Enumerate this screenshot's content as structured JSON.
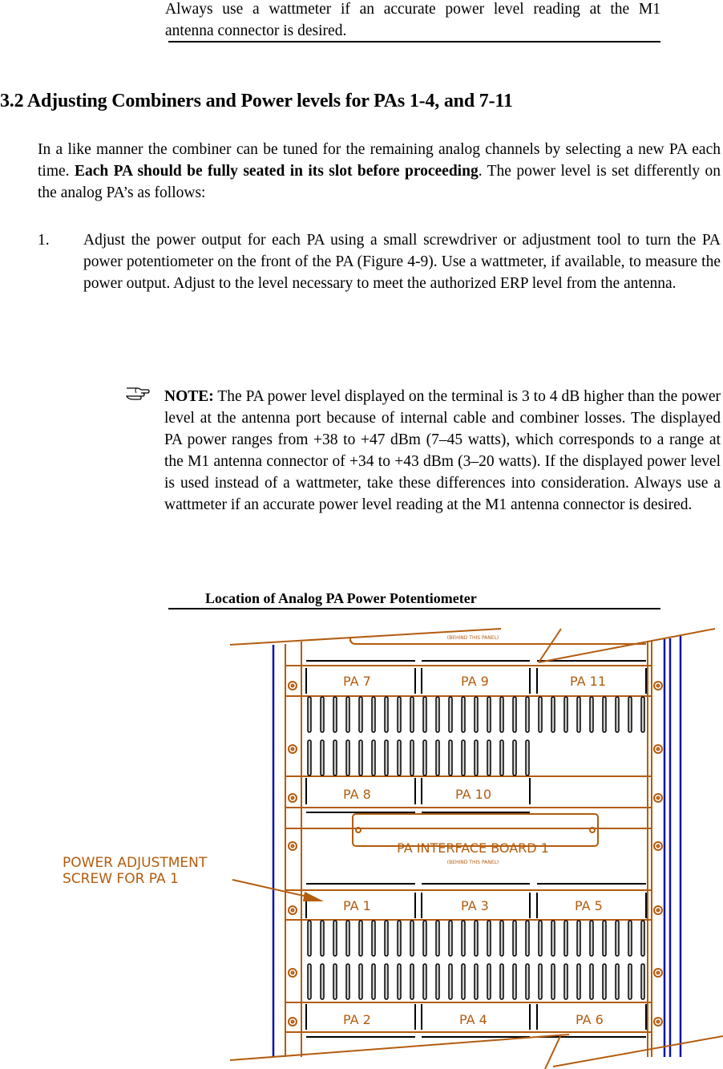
{
  "top_note_tail": {
    "line1": "Always use a wattmeter if an accurate power level reading at the M1",
    "line2": "antenna connector is desired."
  },
  "section": {
    "title": "3.2 Adjusting Combiners and Power levels for PAs 1-4, and 7-11",
    "intro_before_bold": "In a like manner the combiner can be tuned for the remaining analog channels by selecting a new PA each time.  ",
    "intro_bold": "Each PA should be fully seated in its slot before proceeding",
    "intro_after_bold": ". The power level is set differently on the analog PA’s as follows:"
  },
  "steps": [
    {
      "number": "1.",
      "text": "Adjust the power output for each PA using a small screwdriver or adjustment tool to turn the PA power potentiometer on the front of the PA (Figure 4-9).  Use a wattmeter, if available, to measure the power output.  Adjust to the level necessary to meet the authorized ERP level from the antenna."
    }
  ],
  "note": {
    "icon": "pointing-hand-icon",
    "label": "NOTE:",
    "text": "  The PA power level displayed on the terminal is 3 to 4 dB higher than the power level at the antenna port because of internal cable and combiner losses.  The displayed PA power ranges from +38 to +47 dBm (7–45 watts), which corresponds to a range at the M1 antenna connector of +34 to +43 dBm (3–20 watts).  If the displayed power level is used instead of a wattmeter, take these differences into consideration. Always use a wattmeter if an accurate power level reading at the M1 antenna connector is desired."
  },
  "figure": {
    "caption": "Location of Analog PA Power Potentiometer",
    "callout_line1": "POWER ADJUSTMENT",
    "callout_line2": "SCREW FOR PA 1",
    "interface_board_label": "PA INTERFACE BOARD 1",
    "panel_sublabel": "(BEHIND THIS PANEL)",
    "pa_labels_top_row": [
      "PA 7",
      "PA 9",
      "PA 11"
    ],
    "pa_labels_second_row": [
      "PA 8",
      "PA 10"
    ],
    "pa_labels_third_row": [
      "PA 1",
      "PA 3",
      "PA 5"
    ],
    "pa_labels_bottom_row": [
      "PA 2",
      "PA 4",
      "PA 6"
    ],
    "colors": {
      "cad_orange": "#b35c0e",
      "rack_blue": "#0a14a8",
      "ink": "#000000"
    }
  }
}
